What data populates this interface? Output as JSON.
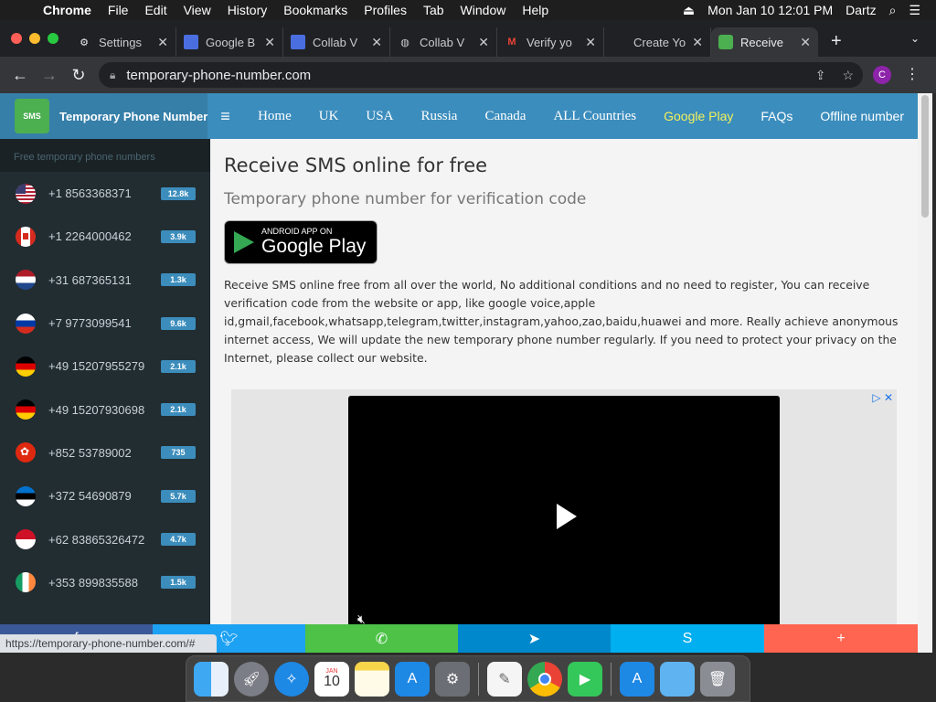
{
  "menubar": {
    "app": "Chrome",
    "items": [
      "File",
      "Edit",
      "View",
      "History",
      "Bookmarks",
      "Profiles",
      "Tab",
      "Window",
      "Help"
    ],
    "datetime": "Mon Jan 10  12:01 PM",
    "user": "Dartz"
  },
  "tabs": [
    {
      "title": "Settings",
      "icon": "gear-icon"
    },
    {
      "title": "Google B",
      "icon": "google-classroom-icon"
    },
    {
      "title": "Collab V",
      "icon": "google-classroom-icon"
    },
    {
      "title": "Collab V",
      "icon": "globe-icon"
    },
    {
      "title": "Verify yo",
      "icon": "gmail-icon"
    },
    {
      "title": "Create Yo",
      "icon": "apple-icon"
    },
    {
      "title": "Receive",
      "icon": "sms-icon",
      "active": true
    }
  ],
  "toolbar": {
    "url": "temporary-phone-number.com",
    "profile_initial": "C"
  },
  "site": {
    "brand": "Temporary Phone Number",
    "logo_text": "SMS",
    "nav": [
      "Home",
      "UK",
      "USA",
      "Russia",
      "Canada",
      "ALL Countries"
    ],
    "nav_right": [
      "Google Play",
      "FAQs",
      "Offline number"
    ]
  },
  "sidebar": {
    "heading": "Free temporary phone numbers",
    "numbers": [
      {
        "number": "+1 8563368371",
        "count": "12.8k",
        "flag": "us"
      },
      {
        "number": "+1 2264000462",
        "count": "3.9k",
        "flag": "ca"
      },
      {
        "number": "+31 687365131",
        "count": "1.3k",
        "flag": "nl"
      },
      {
        "number": "+7 9773099541",
        "count": "9.6k",
        "flag": "ru"
      },
      {
        "number": "+49 15207955279",
        "count": "2.1k",
        "flag": "de"
      },
      {
        "number": "+49 15207930698",
        "count": "2.1k",
        "flag": "de"
      },
      {
        "number": "+852 53789002",
        "count": "735",
        "flag": "hk"
      },
      {
        "number": "+372 54690879",
        "count": "5.7k",
        "flag": "ee"
      },
      {
        "number": "+62 83865326472",
        "count": "4.7k",
        "flag": "id"
      },
      {
        "number": "+353 899835588",
        "count": "1.5k",
        "flag": "ie"
      }
    ]
  },
  "main": {
    "title": "Receive SMS online for free",
    "subtitle": "Temporary phone number for verification code",
    "play_badge_line1": "ANDROID APP ON",
    "play_badge_line2": "Google Play",
    "description": "Receive SMS online free from all over the world, No additional conditions and no need to register, You can receive verification code from the website or app, like google voice,apple id,gmail,facebook,whatsapp,telegram,twitter,instagram,yahoo,zao,baidu,huawei and more. Really achieve anonymous internet access, We will update the new temporary phone number regularly. If you need to protect your privacy on the Internet, please collect our website."
  },
  "sharebar": [
    {
      "icon": "facebook-icon",
      "color": "#3b5998"
    },
    {
      "icon": "twitter-icon",
      "color": "#1da1f2"
    },
    {
      "icon": "whatsapp-icon",
      "color": "#4dc247"
    },
    {
      "icon": "telegram-icon",
      "color": "#0088cc"
    },
    {
      "icon": "skype-icon",
      "color": "#00aff0"
    },
    {
      "icon": "plus-icon",
      "color": "#ff6550"
    }
  ],
  "status_url": "https://temporary-phone-number.com/#",
  "dock": {
    "calendar_month": "JAN",
    "calendar_day": "10",
    "apps": [
      "finder-icon",
      "launchpad-icon",
      "safari-icon",
      "calendar-icon",
      "notes-icon",
      "app-store-icon",
      "system-preferences-icon",
      "textedit-icon",
      "chrome-icon",
      "facetime-icon",
      "app-store-icon",
      "downloads-folder-icon",
      "trash-icon"
    ]
  },
  "colors": {
    "topnav": "#3b8dbd",
    "sidebar": "#222d32",
    "badge": "#3c8dbc",
    "google_play_link": "#f3f15a"
  }
}
